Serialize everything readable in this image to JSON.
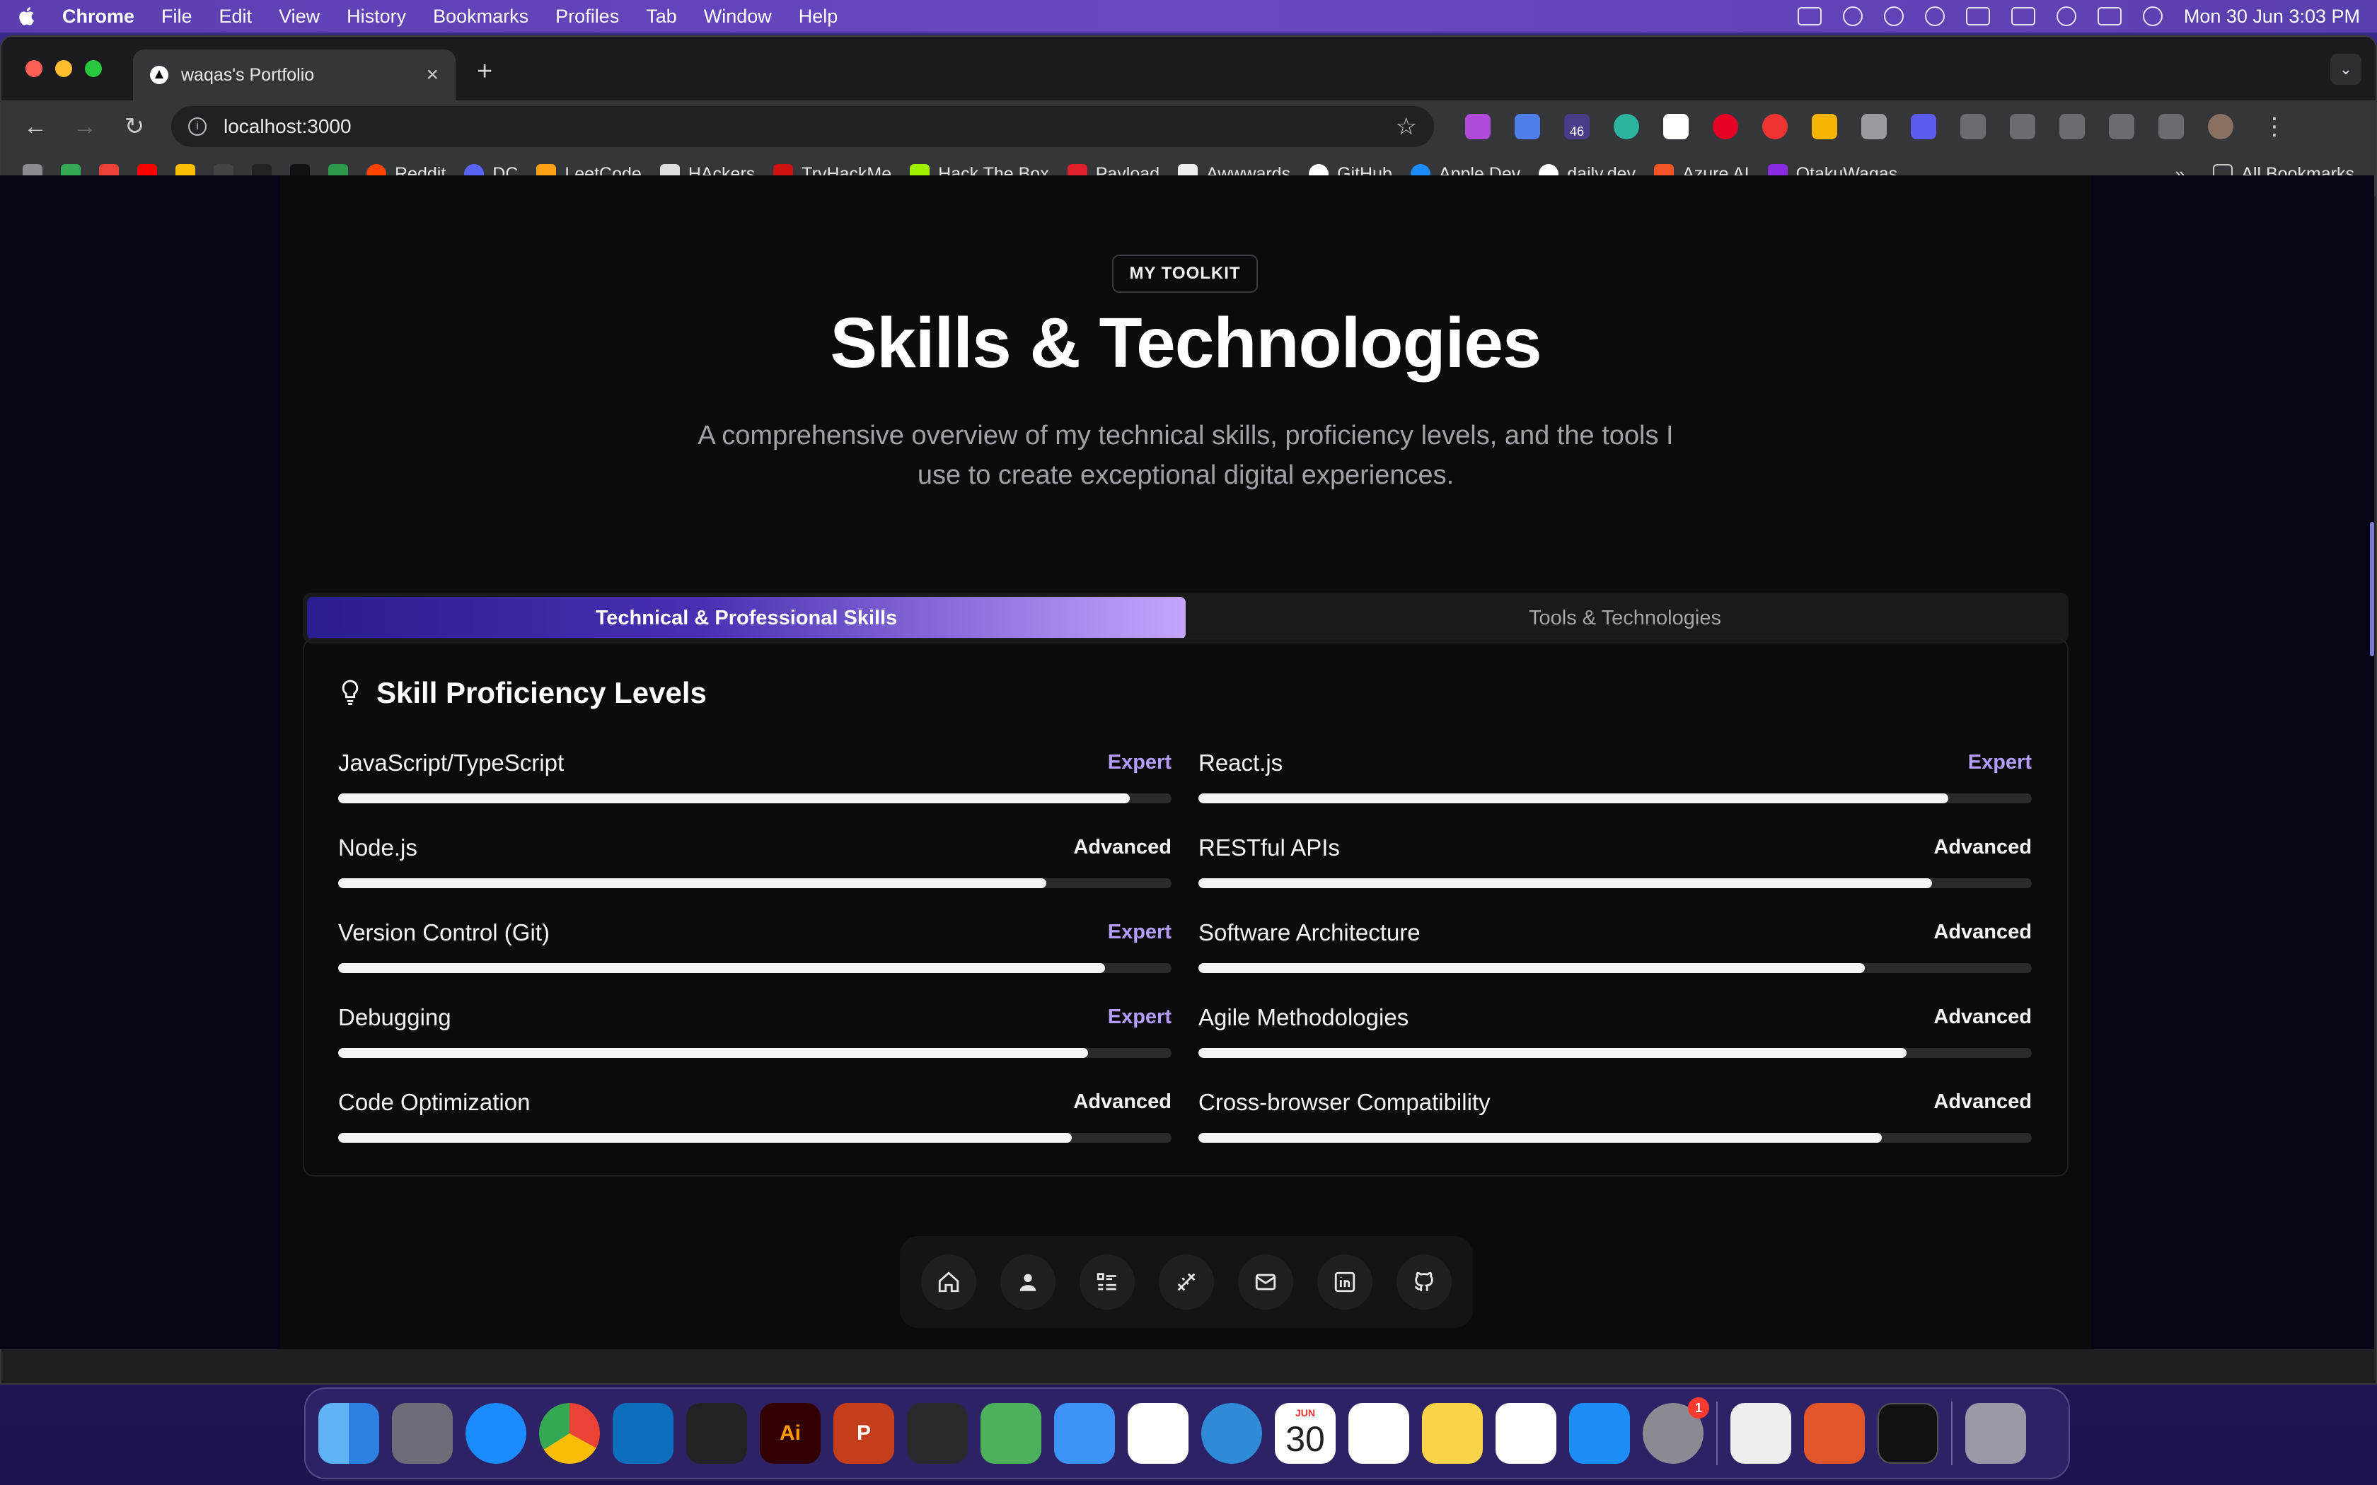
{
  "menubar": {
    "app_name": "Chrome",
    "items": [
      "File",
      "Edit",
      "View",
      "History",
      "Bookmarks",
      "Profiles",
      "Tab",
      "Window",
      "Help"
    ],
    "datetime": "Mon 30 Jun  3:03 PM"
  },
  "browser": {
    "tab_title": "waqas's Portfolio",
    "url": "localhost:3000",
    "extension_badge": "46",
    "bookmarks": [
      "Reddit",
      "DC",
      "LeetCode",
      "HAckers",
      "TryHackMe",
      "Hack The Box",
      "Payload",
      "Awwwards",
      "GitHub",
      "Apple Dev",
      "daily.dev",
      "Azure AI",
      "OtakuWaqas"
    ],
    "all_bookmarks": "All Bookmarks"
  },
  "page": {
    "badge": "MY TOOLKIT",
    "title": "Skills & Technologies",
    "subtitle": "A comprehensive overview of my technical skills, proficiency levels, and the tools I use to create exceptional digital experiences.",
    "tabs": [
      {
        "label": "Technical & Professional Skills",
        "active": true
      },
      {
        "label": "Tools & Technologies",
        "active": false
      }
    ],
    "card_title": "Skill Proficiency Levels",
    "skills": [
      {
        "name": "JavaScript/TypeScript",
        "level": "Expert",
        "progress": 95
      },
      {
        "name": "React.js",
        "level": "Expert",
        "progress": 90
      },
      {
        "name": "Node.js",
        "level": "Advanced",
        "progress": 85
      },
      {
        "name": "RESTful APIs",
        "level": "Advanced",
        "progress": 88
      },
      {
        "name": "Version Control (Git)",
        "level": "Expert",
        "progress": 92
      },
      {
        "name": "Software Architecture",
        "level": "Advanced",
        "progress": 80
      },
      {
        "name": "Debugging",
        "level": "Expert",
        "progress": 90
      },
      {
        "name": "Agile Methodologies",
        "level": "Advanced",
        "progress": 85
      },
      {
        "name": "Code Optimization",
        "level": "Advanced",
        "progress": 88
      },
      {
        "name": "Cross-browser Compatibility",
        "level": "Advanced",
        "progress": 82
      }
    ],
    "floating_nav": [
      "home-icon",
      "user-icon",
      "list-icon",
      "tools-icon",
      "mail-icon",
      "linkedin-icon",
      "github-icon"
    ]
  },
  "dock": {
    "calendar_month": "JUN",
    "calendar_day": "30",
    "settings_badge": "1",
    "illustrator_label": "Ai",
    "powerpoint_label": "P"
  },
  "colors": {
    "accent": "#b59cff",
    "page_bg": "#0b0b0c"
  }
}
